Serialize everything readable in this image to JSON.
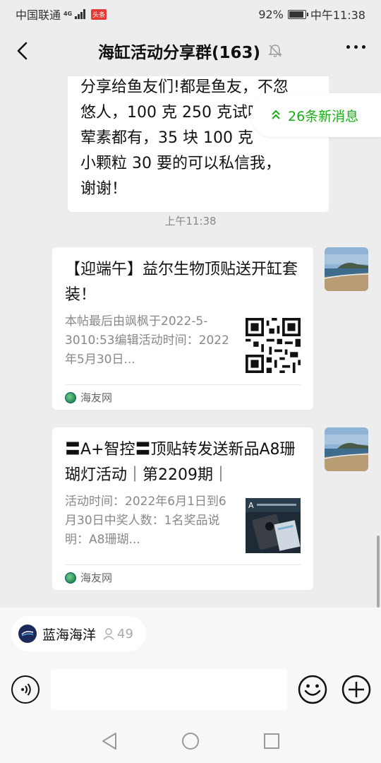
{
  "status": {
    "carrier": "中国联通",
    "network": "4G",
    "app_badge": "头条",
    "battery": "92%",
    "time": "中午11:38",
    "battery_level": 0.92
  },
  "header": {
    "title": "海缸活动分享群(163)"
  },
  "chat": {
    "previous_message": {
      "lines": [
        "分享给鱼友们!都是鱼友，不忽",
        "悠人，100 克 250 克试吃装",
        "荤素都有，35 块 100 克",
        "小颗粒 30 要的可以私信我，",
        "谢谢！"
      ]
    },
    "new_messages_label": "26条新消息",
    "timestamp": "上午11:38",
    "cards": [
      {
        "title": "【迎端午】益尔生物顶贴送开缸套装！",
        "description": "本帖最后由飒枫于2022-5-3010:53编辑活动时间：2022年5月30日...",
        "source": "海友网"
      },
      {
        "title": "〓A+智控〓顶贴转发送新品A8珊 瑚灯活动｜第2209期｜",
        "description": "活动时间：2022年6月1日到6月30日中奖人数：1名奖品说明：A8珊瑚...",
        "source": "海友网"
      }
    ]
  },
  "channel_chip": {
    "name": "蓝海海洋",
    "count": "49"
  },
  "input": {
    "placeholder": ""
  },
  "colors": {
    "accent_green": "#1aad19",
    "background": "#ededed"
  },
  "icons": [
    "back-arrow-icon",
    "mute-bell-icon",
    "more-dots-icon",
    "double-chevron-up-icon",
    "voice-icon",
    "emoji-icon",
    "plus-icon",
    "nav-back-icon",
    "nav-home-icon",
    "nav-recent-icon",
    "person-icon"
  ]
}
